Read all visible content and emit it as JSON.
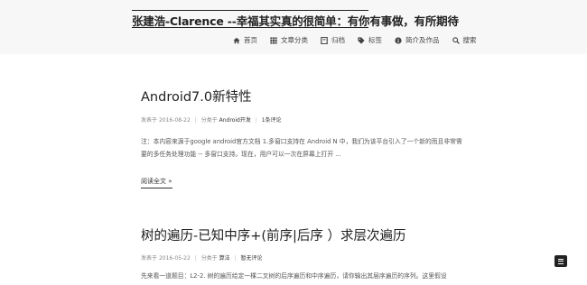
{
  "site": {
    "title": "张建浩-Clarence --幸福其实真的很简单：有你有事做，有所期待"
  },
  "nav": {
    "items": [
      {
        "label": "首页",
        "icon": "home-icon"
      },
      {
        "label": "文章分类",
        "icon": "grid-icon"
      },
      {
        "label": "归档",
        "icon": "archive-icon"
      },
      {
        "label": "标签",
        "icon": "tag-icon"
      },
      {
        "label": "简介及作品",
        "icon": "info-icon"
      },
      {
        "label": "搜索",
        "icon": "search-icon"
      }
    ]
  },
  "posts": [
    {
      "title": "Android7.0新特性",
      "date_prefix": "发表于",
      "date": "2016-08-22",
      "category_prefix": "分类于",
      "category": "Android开发",
      "comments": "1条评论",
      "excerpt": "注：本内容来源于google android官方文档 1.多窗口支持在 Android N 中，我们为该平台引入了一个新的而且非常需要的多任务处理功能 -- 多窗口支持。现在，用户可以一次在屏幕上打开 ...",
      "read_more": "阅读全文 »"
    },
    {
      "title": "树的遍历-已知中序+(前序|后序 ）求层次遍历",
      "date_prefix": "发表于",
      "date": "2016-05-22",
      "category_prefix": "分类于",
      "category": "算法",
      "comments": "暂无评论",
      "excerpt": "先来看一道题目：L2-2. 树的遍历给定一棵二叉树的后序遍历和中序遍历，请你输出其层序遍历的序列。这里假设"
    }
  ],
  "colors": {
    "header_bg": "#f7f7f7",
    "text_dark": "#222222",
    "meta": "#888888",
    "menu_button": "#222222"
  }
}
